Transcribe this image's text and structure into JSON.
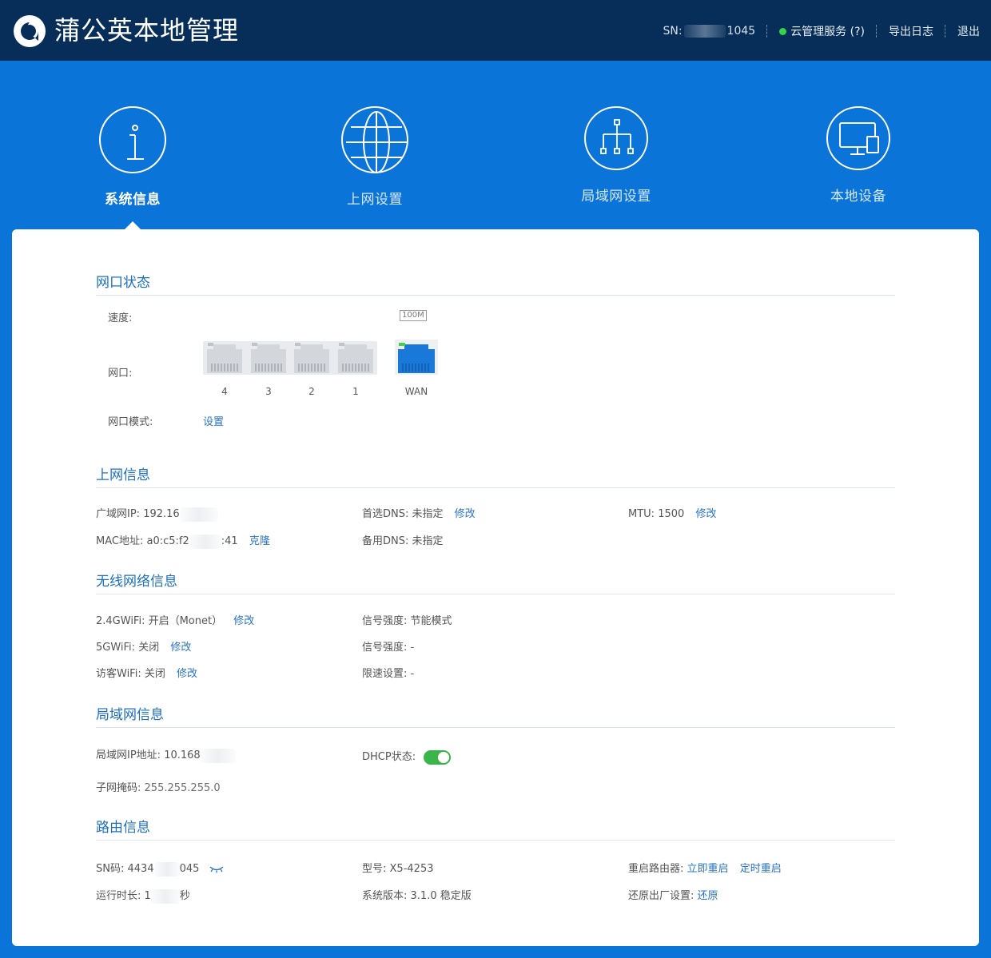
{
  "header": {
    "title": "蒲公英本地管理",
    "sn_prefix": "SN:",
    "sn_suffix": "1045",
    "cloud_service": "云管理服务 (?)",
    "export_log": "导出日志",
    "logout": "退出",
    "cloud_status_color": "#35d24a"
  },
  "nav": {
    "items": [
      {
        "label": "系统信息",
        "icon": "info-icon"
      },
      {
        "label": "上网设置",
        "icon": "globe-icon"
      },
      {
        "label": "局域网设置",
        "icon": "network-tree-icon"
      },
      {
        "label": "本地设备",
        "icon": "devices-icon"
      }
    ],
    "active": 0
  },
  "port_status": {
    "title": "网口状态",
    "speed_label": "速度:",
    "speed_value": "100M",
    "port_label": "网口:",
    "ports": [
      "4",
      "3",
      "2",
      "1"
    ],
    "wan_label": "WAN",
    "mode_label": "网口模式:",
    "mode_link": "设置"
  },
  "internet_info": {
    "title": "上网信息",
    "wan_ip_label": "广域网IP:",
    "wan_ip_value": "192.16",
    "mac_label": "MAC地址:",
    "mac_value_start": "a0:c5:f2",
    "mac_value_end": ":41",
    "mac_clone": "克隆",
    "dns1_label": "首选DNS:",
    "dns1_value": "未指定",
    "dns1_edit": "修改",
    "dns2_label": "备用DNS:",
    "dns2_value": "未指定",
    "mtu_label": "MTU:",
    "mtu_value": "1500",
    "mtu_edit": "修改"
  },
  "wireless_info": {
    "title": "无线网络信息",
    "wifi24_label": "2.4GWiFi:",
    "wifi24_value": "开启（Monet）",
    "wifi24_edit": "修改",
    "wifi5_label": "5GWiFi:",
    "wifi5_value": "关闭",
    "wifi5_edit": "修改",
    "guest_label": "访客WiFi:",
    "guest_value": "关闭",
    "guest_edit": "修改",
    "signal_label": "信号强度:",
    "signal_value": "节能模式",
    "signal5_label": "信号强度:",
    "signal5_value": "-",
    "limit_label": "限速设置:",
    "limit_value": "-"
  },
  "lan_info": {
    "title": "局域网信息",
    "lan_ip_label": "局域网IP地址:",
    "lan_ip_value": "10.168",
    "mask_label": "子网掩码:",
    "mask_value": "255.255.255.0",
    "dhcp_label": "DHCP状态:",
    "dhcp_on": true
  },
  "router_info": {
    "title": "路由信息",
    "sn_label": "SN码:",
    "sn_value_start": "4434",
    "sn_value_end": "045",
    "model_label": "型号:",
    "model_value": "X5-4253",
    "reboot_label": "重启路由器:",
    "reboot_now": "立即重启",
    "reboot_schedule": "定时重启",
    "uptime_label": "运行时长:",
    "uptime_value_start": "1",
    "uptime_value_end": "秒",
    "version_label": "系统版本:",
    "version_value": "3.1.0 稳定版",
    "reset_label": "还原出厂设置:",
    "reset_link": "还原"
  }
}
